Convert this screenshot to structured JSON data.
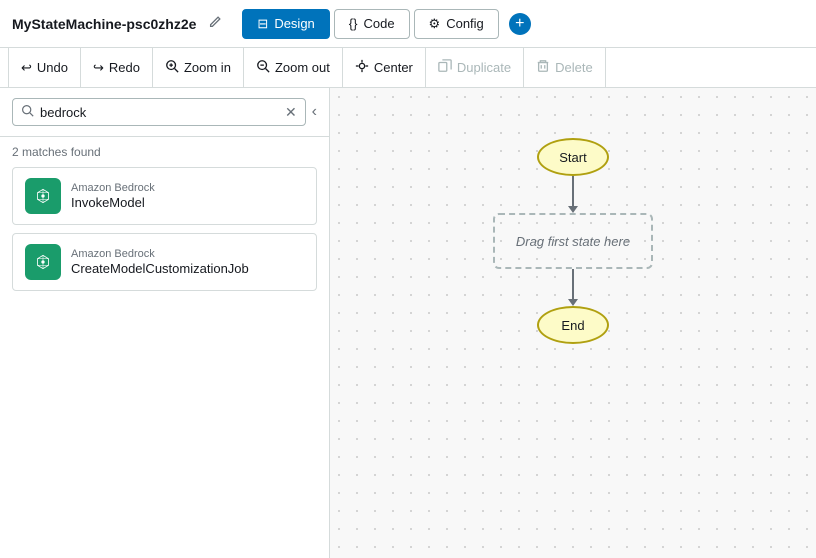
{
  "topbar": {
    "title": "MyStateMachine-psc0zhz2e",
    "tabs": [
      {
        "id": "design",
        "label": "Design",
        "icon": "⊟",
        "active": true
      },
      {
        "id": "code",
        "label": "Code",
        "icon": "{}",
        "active": false
      },
      {
        "id": "config",
        "label": "Config",
        "icon": "⚙",
        "active": false
      }
    ],
    "add_button": "+"
  },
  "toolbar": {
    "buttons": [
      {
        "id": "undo",
        "label": "Undo",
        "icon": "↩",
        "disabled": false
      },
      {
        "id": "redo",
        "label": "Redo",
        "icon": "↪",
        "disabled": false
      },
      {
        "id": "zoom-in",
        "label": "Zoom in",
        "icon": "⊕",
        "disabled": false
      },
      {
        "id": "zoom-out",
        "label": "Zoom out",
        "icon": "⊖",
        "disabled": false
      },
      {
        "id": "center",
        "label": "Center",
        "icon": "◎",
        "disabled": false
      },
      {
        "id": "duplicate",
        "label": "Duplicate",
        "icon": "⧉",
        "disabled": true
      },
      {
        "id": "delete",
        "label": "Delete",
        "icon": "🗑",
        "disabled": true
      }
    ]
  },
  "search": {
    "value": "bedrock",
    "placeholder": "Search",
    "matches_label": "2 matches found"
  },
  "results": [
    {
      "id": "invoke-model",
      "category": "Amazon Bedrock",
      "name": "InvokeModel"
    },
    {
      "id": "create-model-customization-job",
      "category": "Amazon Bedrock",
      "name": "CreateModelCustomizationJob"
    }
  ],
  "flow": {
    "start_label": "Start",
    "drag_label": "Drag first state here",
    "end_label": "End"
  },
  "icons": {
    "edit": "✎",
    "search": "🔍",
    "clear": "✕",
    "collapse": "‹"
  }
}
